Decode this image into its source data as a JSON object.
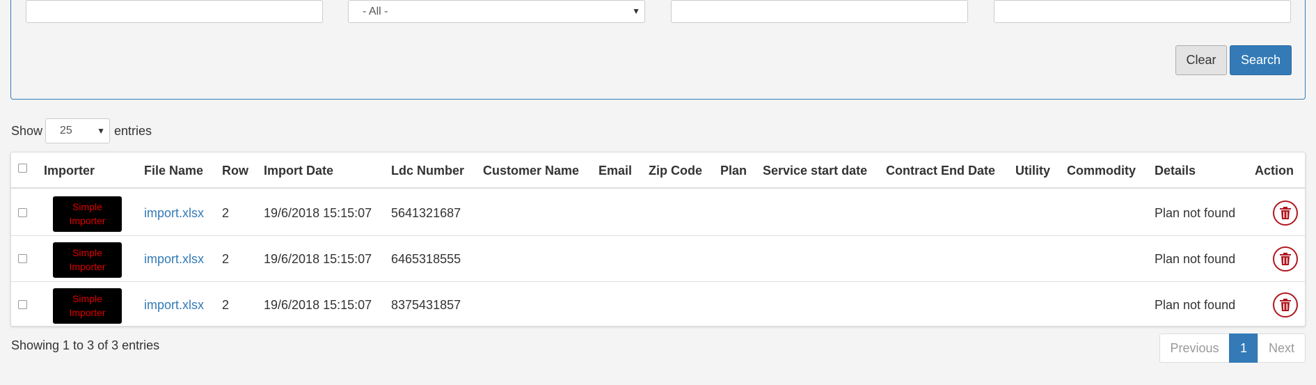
{
  "filters": {
    "input1": {
      "value": ""
    },
    "type_select": {
      "value": "- All -"
    },
    "input3": {
      "value": ""
    },
    "input4": {
      "value": ""
    },
    "clear_label": "Clear",
    "search_label": "Search"
  },
  "length": {
    "show_label": "Show",
    "value": "25",
    "entries_label": "entries"
  },
  "table": {
    "columns": [
      "Importer",
      "File Name",
      "Row",
      "Import Date",
      "Ldc Number",
      "Customer Name",
      "Email",
      "Zip Code",
      "Plan",
      "Service start date",
      "Contract End Date",
      "Utility",
      "Commodity",
      "Details",
      "Action"
    ],
    "rows": [
      {
        "importer_line1": "Simple",
        "importer_line2": "Importer",
        "file": "import.xlsx",
        "row": "2",
        "date": "19/6/2018 15:15:07",
        "ldc": "5641321687",
        "details": "Plan not found"
      },
      {
        "importer_line1": "Simple",
        "importer_line2": "Importer",
        "file": "import.xlsx",
        "row": "2",
        "date": "19/6/2018 15:15:07",
        "ldc": "6465318555",
        "details": "Plan not found"
      },
      {
        "importer_line1": "Simple",
        "importer_line2": "Importer",
        "file": "import.xlsx",
        "row": "2",
        "date": "19/6/2018 15:15:07",
        "ldc": "8375431857",
        "details": "Plan not found"
      }
    ]
  },
  "footer": {
    "info": "Showing 1 to 3 of 3 entries",
    "previous": "Previous",
    "current_page": "1",
    "next": "Next"
  },
  "icons": {
    "delete": "trash-icon",
    "dropdown": "chevron-down-icon"
  },
  "colors": {
    "primary": "#337ab7",
    "badge_bg": "#000000",
    "badge_text": "#e00000",
    "delete": "#b0171f"
  }
}
